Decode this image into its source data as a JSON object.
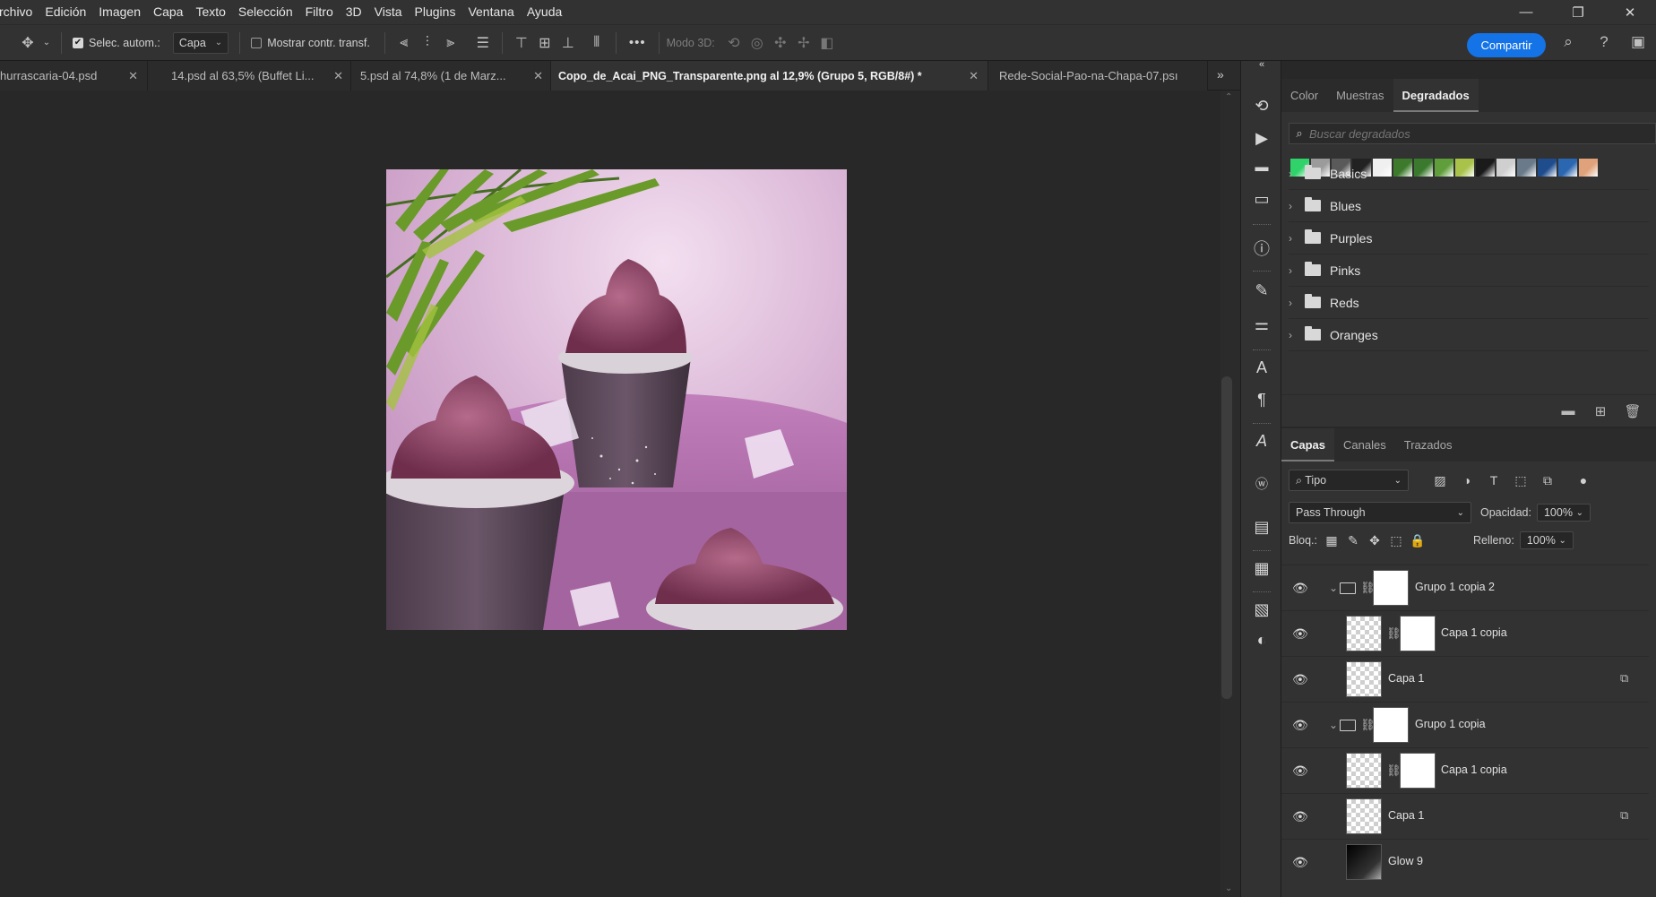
{
  "menu": [
    "rchivo",
    "Edición",
    "Imagen",
    "Capa",
    "Texto",
    "Selección",
    "Filtro",
    "3D",
    "Vista",
    "Plugins",
    "Ventana",
    "Ayuda"
  ],
  "window_controls": [
    "—",
    "❐",
    "✕"
  ],
  "options": {
    "auto_select_label": "Selec. autom.:",
    "auto_select_checked": true,
    "target_value": "Capa",
    "show_transform_label": "Mostrar contr. transf.",
    "more": "•••",
    "mode3d_label": "Modo 3D:",
    "share_label": "Compartir"
  },
  "tabs": [
    {
      "title": "hurrascaria-04.psd",
      "active": false
    },
    {
      "title": "14.psd al 63,5% (Buffet Li...",
      "active": false
    },
    {
      "title": "5.psd al 74,8% (1 de Marz...",
      "active": false
    },
    {
      "title": "Copo_de_Acai_PNG_Transparente.png al 12,9% (Grupo 5, RGB/8#) *",
      "active": true
    },
    {
      "title": "Rede-Social-Pao-na-Chapa-07.psı",
      "active": false
    }
  ],
  "gradients_panel": {
    "tabs": [
      "Color",
      "Muestras",
      "Degradados"
    ],
    "active_tab": "Degradados",
    "search_placeholder": "Buscar degradados",
    "swatch_colors": [
      "#2fd36a",
      "#9b9b9b",
      "#5a5a5a",
      "#222222",
      "#f0f0f0",
      "#3d7a2c",
      "#3b7a2e",
      "#5f9e3a",
      "#a8c24a",
      "#1a1a1a",
      "#cfcfcf",
      "#6a7a8a",
      "#1e4c8c",
      "#2b66b0",
      "#e0a27a"
    ],
    "folders": [
      "Basics",
      "Blues",
      "Purples",
      "Pinks",
      "Reds",
      "Oranges"
    ]
  },
  "layers_panel": {
    "tabs": [
      "Capas",
      "Canales",
      "Trazados"
    ],
    "active_tab": "Capas",
    "filter_label": "Tipo",
    "blend_mode": "Pass Through",
    "opacity_label": "Opacidad:",
    "opacity_value": "100%",
    "lock_label": "Bloq.:",
    "fill_label": "Relleno:",
    "fill_value": "100%",
    "layers": [
      {
        "name": "Grupo 1 copia 2",
        "kind": "group"
      },
      {
        "name": "Capa 1 copia",
        "kind": "masked"
      },
      {
        "name": "Capa 1",
        "kind": "plain"
      },
      {
        "name": "Grupo 1 copia",
        "kind": "group"
      },
      {
        "name": "Capa 1 copia",
        "kind": "masked"
      },
      {
        "name": "Capa 1",
        "kind": "plain"
      },
      {
        "name": "Glow 9",
        "kind": "dark"
      }
    ]
  }
}
